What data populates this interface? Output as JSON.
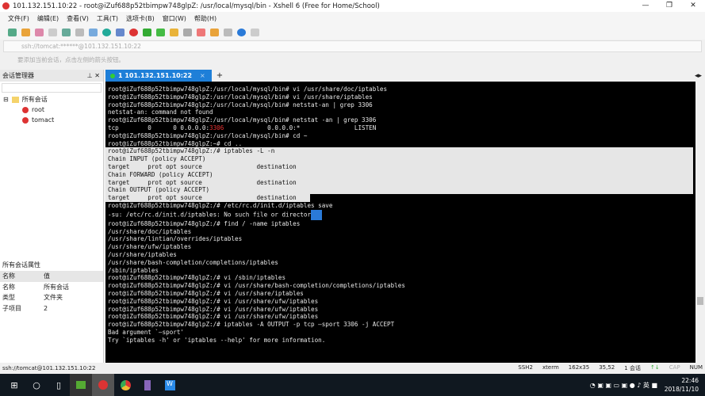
{
  "window": {
    "title": "101.132.151.10:22 - root@iZuf688p52tbimpw748glpZ: /usr/local/mysql/bin - Xshell 6 (Free for Home/School)"
  },
  "menu": [
    "文件(F)",
    "编辑(E)",
    "查看(V)",
    "工具(T)",
    "选项卡(B)",
    "窗口(W)",
    "帮助(H)"
  ],
  "address": "ssh://tomcat:******@101.132.151.10:22",
  "hint": "要添加当前会话，点击左侧的箭头按钮。",
  "session_manager": {
    "title": "会话管理器",
    "root": "所有会话",
    "items": [
      "root",
      "tomact"
    ]
  },
  "properties": {
    "title": "所有会话属性",
    "header": [
      "名称",
      "值"
    ],
    "rows": [
      [
        "名称",
        "所有会话"
      ],
      [
        "类型",
        "文件夹"
      ],
      [
        "子项目",
        "2"
      ]
    ]
  },
  "tab": {
    "label": "1 101.132.151.10:22",
    "add": "+"
  },
  "terminal": {
    "lines": [
      "root@iZuf688p52tbimpw748glpZ:/usr/local/mysql/bin# vi /usr/share/doc/iptables",
      "root@iZuf688p52tbimpw748glpZ:/usr/local/mysql/bin# vi /usr/share/iptables",
      "root@iZuf688p52tbimpw748glpZ:/usr/local/mysql/bin# netstat-an | grep 3306",
      "netstat-an: command not found",
      "root@iZuf688p52tbimpw748glpZ:/usr/local/mysql/bin# netstat -an | grep 3306",
      "__TCP__",
      "root@iZuf688p52tbimpw748glpZ:/usr/local/mysql/bin# cd ~",
      "root@iZuf688p52tbimpw748glpZ:~# cd ..",
      "root@iZuf688p52tbimpw748glpZ:/# iptables -L -n",
      "Chain INPUT (policy ACCEPT)",
      "target     prot opt source               destination",
      "",
      "Chain FORWARD (policy ACCEPT)",
      "target     prot opt source               destination",
      "",
      "Chain OUTPUT (policy ACCEPT)",
      "target     prot opt source               destination",
      "root@iZuf688p52tbimpw748glpZ:/# /etc/rc.d/init.d/iptables save",
      "-su: /etc/rc.d/init.d/iptables: No such file or director",
      "root@iZuf688p52tbimpw748glpZ:/# find / -name iptables",
      "/usr/share/doc/iptables",
      "/usr/share/lintian/overrides/iptables",
      "/usr/share/ufw/iptables",
      "/usr/share/iptables",
      "/usr/share/bash-completion/completions/iptables",
      "/sbin/iptables",
      "root@iZuf688p52tbimpw748glpZ:/# vi /sbin/iptables",
      "root@iZuf688p52tbimpw748glpZ:/# vi /usr/share/bash-completion/completions/iptables",
      "root@iZuf688p52tbimpw748glpZ:/# vi /usr/share/iptables",
      "root@iZuf688p52tbimpw748glpZ:/# vi /usr/share/ufw/iptables",
      "root@iZuf688p52tbimpw748glpZ:/# vi /usr/share/ufw/iptables",
      "root@iZuf688p52tbimpw748glpZ:/# vi /usr/share/ufw/iptables",
      "root@iZuf688p52tbimpw748glpZ:/# iptables -A OUTPUT -p tcp —sport 3306 -j ACCEPT",
      "Bad argument `—sport'",
      "Try `iptables -h' or 'iptables --help' for more information."
    ],
    "tcp_line": {
      "a": "tcp        0      0 0.0.0.0:",
      "port": "3306",
      "b": "            0.0.0.0:*               LISTEN"
    }
  },
  "statusbar": {
    "left": "ssh://tomcat@101.132.151.10:22",
    "protocol": "SSH2",
    "term": "xterm",
    "size": "162x35",
    "pos": "35,52",
    "sessions": "1 会话",
    "caps": "CAP",
    "num": "NUM"
  },
  "taskbar": {
    "time": "22:46",
    "date": "2018/11/10"
  }
}
